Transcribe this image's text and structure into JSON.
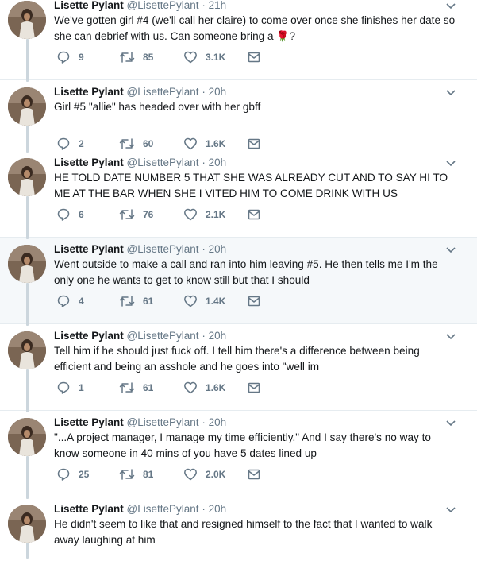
{
  "colors": {
    "accent": "#1da1f2",
    "muted": "#657786",
    "text": "#14171a",
    "thread_line": "#ccd6dd",
    "highlight_bg": "#f5f8fa"
  },
  "icons": {
    "reply": "reply-icon",
    "retweet": "retweet-icon",
    "like": "heart-icon",
    "message": "envelope-icon",
    "caret": "chevron-down-icon",
    "emoji": "rose-emoji"
  },
  "tweets": [
    {
      "author": "Lisette Pylant",
      "handle": "@LisettePylant",
      "separator": "·",
      "time": "21h",
      "text": "We've gotten girl #4 (we'll call her claire) to come over once she finishes her date so she can debrief with us. Can someone bring a",
      "emoji": "🌹",
      "text_after": "?",
      "replies": "9",
      "retweets": "85",
      "likes": "3.1K"
    },
    {
      "author": "Lisette Pylant",
      "handle": "@LisettePylant",
      "separator": "·",
      "time": "20h",
      "text": "Girl #5 \"allie\" has headed over with her gbff",
      "replies": "2",
      "retweets": "60",
      "likes": "1.6K"
    },
    {
      "author": "Lisette Pylant",
      "handle": "@LisettePylant",
      "separator": "·",
      "time": "20h",
      "text": "HE TOLD DATE NUMBER 5 THAT SHE WAS ALREADY CUT AND TO SAY HI TO ME AT THE BAR WHEN SHE I VITED HIM TO COME DRINK WITH US",
      "replies": "6",
      "retweets": "76",
      "likes": "2.1K"
    },
    {
      "author": "Lisette Pylant",
      "handle": "@LisettePylant",
      "separator": "·",
      "time": "20h",
      "text": "Went outside to make a call and ran into him leaving #5. He then tells me I'm the only one he wants to get to know still but that I should",
      "replies": "4",
      "retweets": "61",
      "likes": "1.4K"
    },
    {
      "author": "Lisette Pylant",
      "handle": "@LisettePylant",
      "separator": "·",
      "time": "20h",
      "text": "Tell him if he should just fuck off. I tell him there's a difference between being efficient and being an asshole and he goes into \"well im",
      "replies": "1",
      "retweets": "61",
      "likes": "1.6K"
    },
    {
      "author": "Lisette Pylant",
      "handle": "@LisettePylant",
      "separator": "·",
      "time": "20h",
      "text": "\"...A project manager, I manage my time efficiently.\" And I say there's no way to know someone in 40 mins of you have 5 dates lined up",
      "replies": "25",
      "retweets": "81",
      "likes": "2.0K"
    },
    {
      "author": "Lisette Pylant",
      "handle": "@LisettePylant",
      "separator": "·",
      "time": "20h",
      "text": "He didn't seem to like that and resigned himself to the fact that I wanted to walk away laughing at him"
    }
  ]
}
